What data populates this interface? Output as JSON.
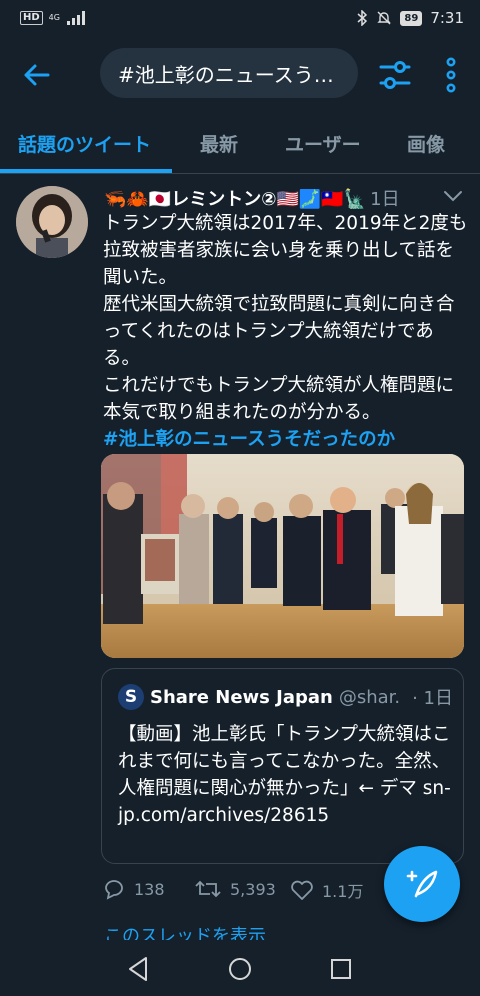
{
  "status_bar": {
    "network": "4G",
    "hd": "HD",
    "battery": "89",
    "time": "7:31"
  },
  "header": {
    "search_query": "#池上彰のニュースう…",
    "back_icon": "arrow-left-icon",
    "filter_icon": "sliders-icon",
    "more_icon": "more-vertical-icon"
  },
  "tabs": [
    {
      "label": "話題のツイート",
      "active": true
    },
    {
      "label": "最新",
      "active": false
    },
    {
      "label": "ユーザー",
      "active": false
    },
    {
      "label": "画像",
      "active": false
    }
  ],
  "tweet": {
    "author": "🦐🦀🇯🇵レミントン②🇺🇸🗾🇹🇼🗽",
    "time": "1日",
    "text": "トランプ大統領は2017年、2019年と2度も拉致被害者家族に会い身を乗り出して話を聞いた。\n歴代米国大統領で拉致問題に真剣に向き合ってくれたのはトランプ大統領だけである。\nこれだけでもトランプ大統領が人権問題に本気で取り組まれたのが分かる。",
    "hashtag": "#池上彰のニュースうそだったのか",
    "quote": {
      "logo_letter": "S",
      "name": "Share News Japan",
      "handle": "@shar...",
      "time": "· 1日",
      "text": "【動画】池上彰氏「トランプ大統領はこれまで何にも言ってこなかった。全然、人権問題に関心が無かった」← デマ sn-jp.com/archives/28615"
    },
    "stats": {
      "replies": "138",
      "retweets": "5,393",
      "likes": "1.1万"
    },
    "show_thread": "このスレッドを表示"
  },
  "colors": {
    "background": "#15202b",
    "accent": "#1da1f2",
    "muted": "#8899a6",
    "border": "#38444d"
  }
}
